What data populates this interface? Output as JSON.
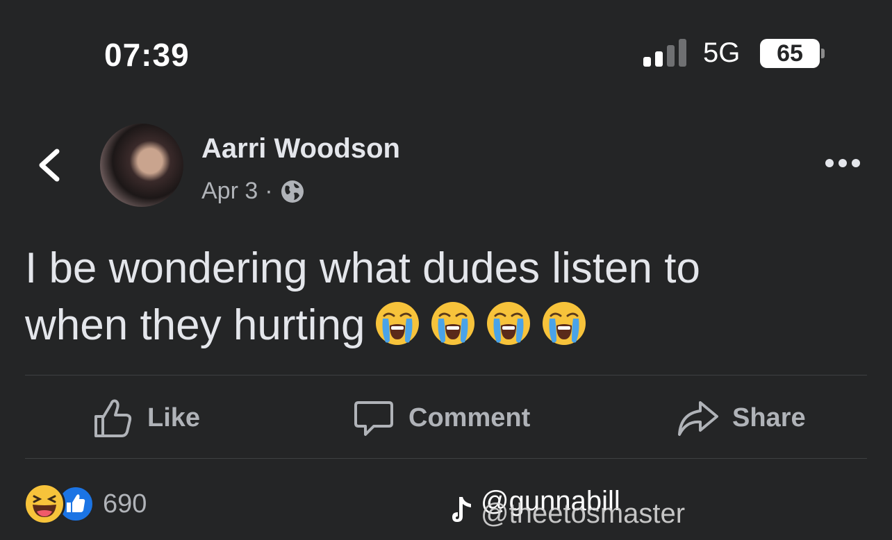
{
  "status_bar": {
    "time": "07:39",
    "network": "5G",
    "battery": "65"
  },
  "post": {
    "author": "Aarri Woodson",
    "date": "Apr 3",
    "separator": "·",
    "privacy_icon": "globe-icon",
    "text_line1": "I be wondering what dudes listen to",
    "text_line2": "when they hurting",
    "emojis": [
      "loudly-crying-face",
      "loudly-crying-face",
      "loudly-crying-face",
      "loudly-crying-face"
    ]
  },
  "actions": {
    "like": "Like",
    "comment": "Comment",
    "share": "Share"
  },
  "reactions": {
    "types": [
      "haha",
      "like"
    ],
    "count": "690"
  },
  "watermark": {
    "handle_1": "@gunnabill",
    "handle_2": "@theetosmaster"
  },
  "colors": {
    "background": "#242526",
    "text": "#e4e6eb",
    "secondary": "#b0b3b8",
    "like_blue": "#1b74e4",
    "haha_yellow": "#f7c33b"
  }
}
